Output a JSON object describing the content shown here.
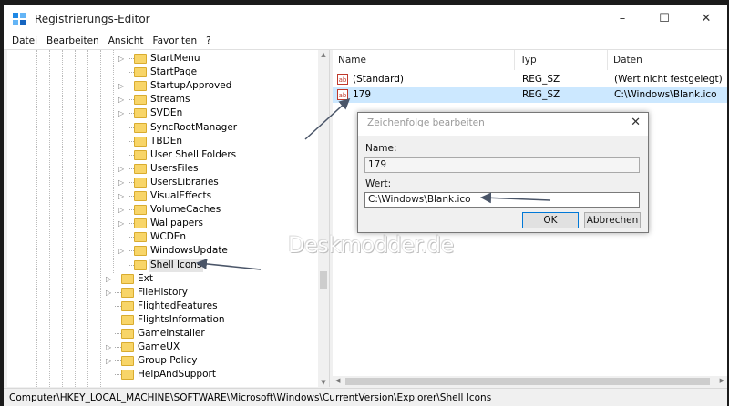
{
  "window": {
    "title": "Registrierungs-Editor",
    "controls": [
      "–",
      "☐",
      "✕"
    ]
  },
  "menubar": {
    "items": [
      "Datei",
      "Bearbeiten",
      "Ansicht",
      "Favoriten",
      "?"
    ]
  },
  "tree": {
    "items": [
      {
        "label": "StartMenu",
        "expander": true
      },
      {
        "label": "StartPage",
        "expander": false
      },
      {
        "label": "StartupApproved",
        "expander": true
      },
      {
        "label": "Streams",
        "expander": true
      },
      {
        "label": "SVDEn",
        "expander": true
      },
      {
        "label": "SyncRootManager",
        "expander": false
      },
      {
        "label": "TBDEn",
        "expander": false
      },
      {
        "label": "User Shell Folders",
        "expander": false
      },
      {
        "label": "UsersFiles",
        "expander": true
      },
      {
        "label": "UsersLibraries",
        "expander": true
      },
      {
        "label": "VisualEffects",
        "expander": true
      },
      {
        "label": "VolumeCaches",
        "expander": true
      },
      {
        "label": "Wallpapers",
        "expander": true
      },
      {
        "label": "WCDEn",
        "expander": false
      },
      {
        "label": "WindowsUpdate",
        "expander": true
      },
      {
        "label": "Shell Icons",
        "expander": false,
        "selected": true
      },
      {
        "label": "Ext",
        "expander": true
      },
      {
        "label": "FileHistory",
        "expander": true
      },
      {
        "label": "FlightedFeatures",
        "expander": false
      },
      {
        "label": "FlightsInformation",
        "expander": false
      },
      {
        "label": "GameInstaller",
        "expander": false
      },
      {
        "label": "GameUX",
        "expander": true
      },
      {
        "label": "Group Policy",
        "expander": true
      },
      {
        "label": "HelpAndSupport",
        "expander": false
      }
    ]
  },
  "list": {
    "columns": [
      "Name",
      "Typ",
      "Daten"
    ],
    "rows": [
      {
        "name": "(Standard)",
        "type": "REG_SZ",
        "data": "(Wert nicht festgelegt)",
        "selected": false
      },
      {
        "name": "179",
        "type": "REG_SZ",
        "data": "C:\\Windows\\Blank.ico",
        "selected": true
      }
    ]
  },
  "dialog": {
    "title": "Zeichenfolge bearbeiten",
    "name_label": "Name:",
    "name_value": "179",
    "value_label": "Wert:",
    "value_value": "C:\\Windows\\Blank.ico",
    "ok_label": "OK",
    "cancel_label": "Abbrechen"
  },
  "statusbar": {
    "path": "Computer\\HKEY_LOCAL_MACHINE\\SOFTWARE\\Microsoft\\Windows\\CurrentVersion\\Explorer\\Shell Icons"
  },
  "watermark": "Deskmodder.de",
  "colors": {
    "selection": "#cce8ff",
    "folder": "#f8d568",
    "accent": "#0078d7"
  }
}
